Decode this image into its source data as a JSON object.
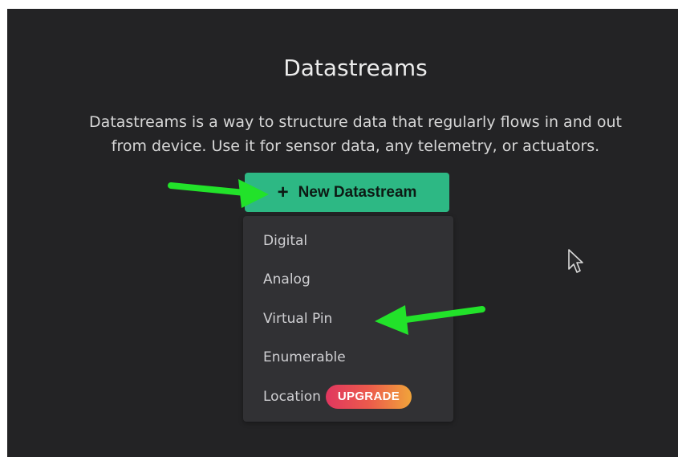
{
  "header": {
    "title": "Datastreams",
    "description_line1": "Datastreams is a way to structure data that regularly flows in and out",
    "description_line2": "from device. Use it for sensor data, any telemetry, or actuators."
  },
  "new_button": {
    "icon": "plus-icon",
    "label": "New Datastream",
    "color": "#2db884"
  },
  "menu": {
    "items": [
      {
        "label": "Digital"
      },
      {
        "label": "Analog"
      },
      {
        "label": "Virtual Pin"
      },
      {
        "label": "Enumerable"
      },
      {
        "label": "Location",
        "badge": "UPGRADE"
      }
    ]
  },
  "annotations": {
    "arrow_color": "#22e22a",
    "arrows": [
      "arrow-pointing-to-new-datastream",
      "arrow-pointing-to-virtual-pin"
    ]
  },
  "colors": {
    "panel_bg": "#232325",
    "menu_bg": "#313134",
    "badge_gradient": [
      "#e0375f",
      "#f0a43a"
    ]
  }
}
